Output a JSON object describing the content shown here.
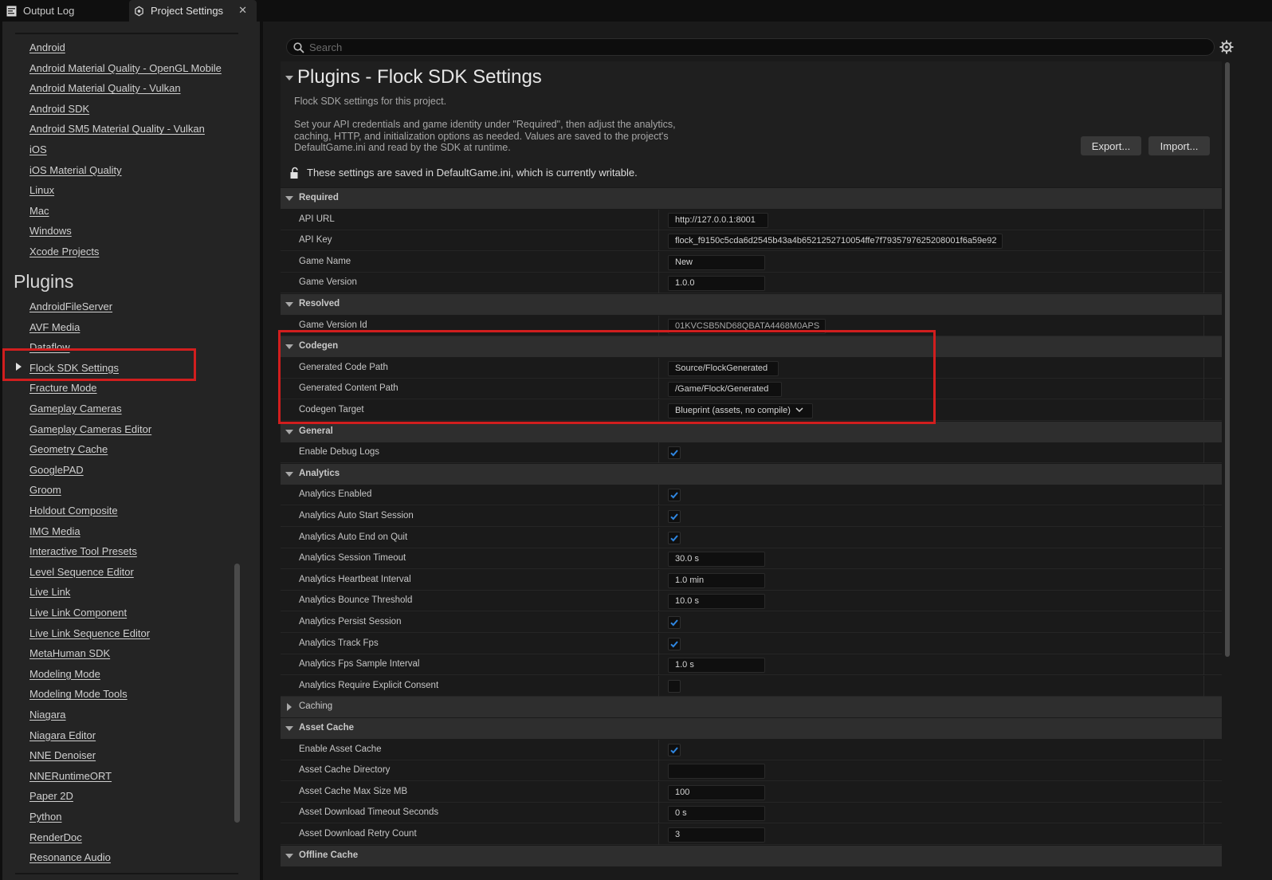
{
  "tabs": {
    "output_log": "Output Log",
    "project_settings": "Project Settings",
    "close_glyph": "✕"
  },
  "nav": {
    "platform_items": [
      "Android",
      "Android Material Quality - OpenGL Mobile",
      "Android Material Quality - Vulkan",
      "Android SDK",
      "Android SM5 Material Quality - Vulkan",
      "iOS",
      "iOS Material Quality",
      "Linux",
      "Mac",
      "Windows",
      "Xcode Projects"
    ],
    "plugins_header": "Plugins",
    "plugin_items": [
      "AndroidFileServer",
      "AVF Media",
      "Dataflow",
      "Flock SDK Settings",
      "Fracture Mode",
      "Gameplay Cameras",
      "Gameplay Cameras Editor",
      "Geometry Cache",
      "GooglePAD",
      "Groom",
      "Holdout Composite",
      "IMG Media",
      "Interactive Tool Presets",
      "Level Sequence Editor",
      "Live Link",
      "Live Link Component",
      "Live Link Sequence Editor",
      "MetaHuman SDK",
      "Modeling Mode",
      "Modeling Mode Tools",
      "Niagara",
      "Niagara Editor",
      "NNE Denoiser",
      "NNERuntimeORT",
      "Paper 2D",
      "Python",
      "RenderDoc",
      "Resonance Audio"
    ],
    "selected": "Flock SDK Settings"
  },
  "search": {
    "placeholder": "Search"
  },
  "header": {
    "title": "Plugins - Flock SDK Settings",
    "description": "Flock SDK settings for this project.",
    "detail": "Set your API credentials and game identity under \"Required\", then adjust the analytics, caching, HTTP, and initialization options as needed. Values are saved to the project's DefaultGame.ini and read by the SDK at runtime.",
    "export_label": "Export...",
    "import_label": "Import...",
    "writable_note": "These settings are saved in DefaultGame.ini, which is currently writable."
  },
  "categories": {
    "required": "Required",
    "resolved": "Resolved",
    "codegen": "Codegen",
    "general": "General",
    "analytics": "Analytics",
    "caching": "Caching",
    "asset_cache": "Asset Cache",
    "offline_cache": "Offline Cache"
  },
  "props": {
    "api_url": {
      "label": "API URL",
      "value": "http://127.0.0.1:8001"
    },
    "api_key": {
      "label": "API Key",
      "value": "flock_f9150c5cda6d2545b43a4b6521252710054ffe7f7935797625208001f6a59e92"
    },
    "game_name": {
      "label": "Game Name",
      "value": "New"
    },
    "game_version": {
      "label": "Game Version",
      "value": "1.0.0"
    },
    "game_version_id": {
      "label": "Game Version Id",
      "value": "01KVCSB5ND68QBATA4468M0APS"
    },
    "generated_code_path": {
      "label": "Generated Code Path",
      "value": "Source/FlockGenerated"
    },
    "generated_content_path": {
      "label": "Generated Content Path",
      "value": "/Game/Flock/Generated"
    },
    "codegen_target": {
      "label": "Codegen Target",
      "value": "Blueprint (assets, no compile)"
    },
    "enable_debug_logs": {
      "label": "Enable Debug Logs",
      "checked": true
    },
    "analytics_enabled": {
      "label": "Analytics Enabled",
      "checked": true
    },
    "analytics_auto_start_session": {
      "label": "Analytics Auto Start Session",
      "checked": true
    },
    "analytics_auto_end_on_quit": {
      "label": "Analytics Auto End on Quit",
      "checked": true
    },
    "analytics_session_timeout": {
      "label": "Analytics Session Timeout",
      "value": "30.0 s"
    },
    "analytics_heartbeat_interval": {
      "label": "Analytics Heartbeat Interval",
      "value": "1.0 min"
    },
    "analytics_bounce_threshold": {
      "label": "Analytics Bounce Threshold",
      "value": "10.0 s"
    },
    "analytics_persist_session": {
      "label": "Analytics Persist Session",
      "checked": true
    },
    "analytics_track_fps": {
      "label": "Analytics Track Fps",
      "checked": true
    },
    "analytics_fps_sample_interval": {
      "label": "Analytics Fps Sample Interval",
      "value": "1.0 s"
    },
    "analytics_require_explicit_consent": {
      "label": "Analytics Require Explicit Consent",
      "checked": false
    },
    "enable_asset_cache": {
      "label": "Enable Asset Cache",
      "checked": true
    },
    "asset_cache_directory": {
      "label": "Asset Cache Directory",
      "value": ""
    },
    "asset_cache_max_size_mb": {
      "label": "Asset Cache Max Size MB",
      "value": "100"
    },
    "asset_download_timeout_seconds": {
      "label": "Asset Download Timeout Seconds",
      "value": "0 s"
    },
    "asset_download_retry_count": {
      "label": "Asset Download Retry Count",
      "value": "3"
    }
  },
  "colors": {
    "highlight_box": "#d11e1e",
    "checkbox_check": "#2f86e0",
    "panel_bg": "#1a1a1a",
    "category_bg": "#2e2e2e"
  },
  "icons": [
    "output-log-icon",
    "project-settings-icon",
    "close-icon",
    "search-icon",
    "gear-icon",
    "lock-icon",
    "checkmark-icon",
    "chevron-down-icon",
    "expand-arrow-icon"
  ]
}
